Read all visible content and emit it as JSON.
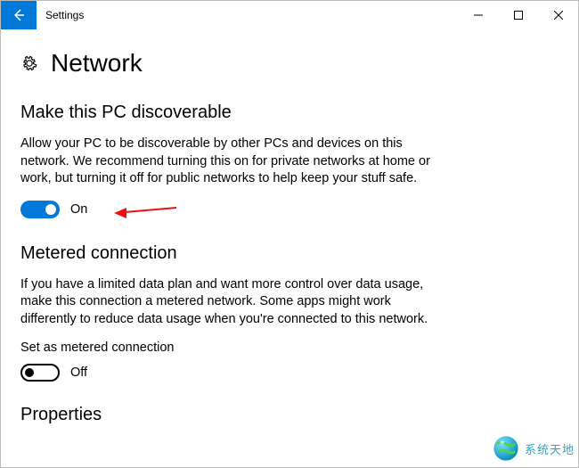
{
  "window": {
    "title": "Settings"
  },
  "page": {
    "title": "Network"
  },
  "discoverable": {
    "heading": "Make this PC discoverable",
    "description": "Allow your PC to be discoverable by other PCs and devices on this network. We recommend turning this on for private networks at home or work, but turning it off for public networks to help keep your stuff safe.",
    "toggle_state": "On"
  },
  "metered": {
    "heading": "Metered connection",
    "description": "If you have a limited data plan and want more control over data usage, make this connection a metered network. Some apps might work differently to reduce data usage when you're connected to this network.",
    "sub_label": "Set as metered connection",
    "toggle_state": "Off"
  },
  "properties": {
    "heading": "Properties"
  },
  "watermark": {
    "text": "系统天地"
  }
}
